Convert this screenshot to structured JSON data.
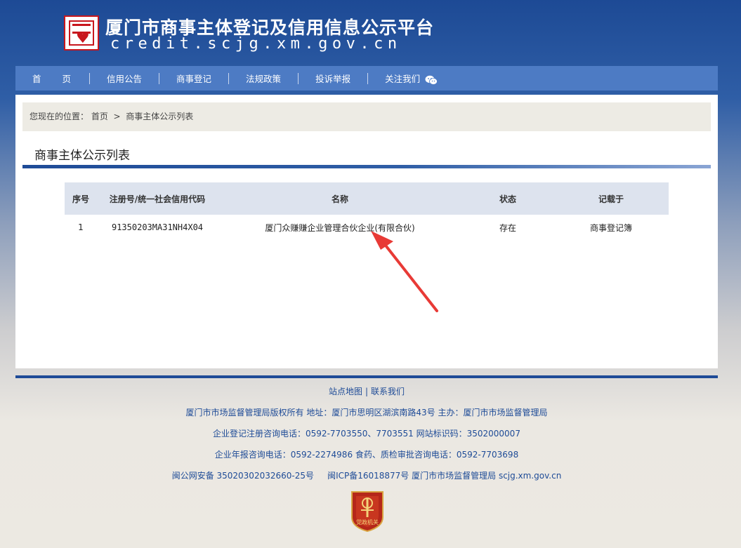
{
  "header": {
    "title": "厦门市商事主体登记及信用信息公示平台",
    "url": "credit.scjg.xm.gov.cn",
    "logo_icon": "credit-logo-icon"
  },
  "nav": {
    "items": [
      {
        "label": "首页"
      },
      {
        "label": "信用公告"
      },
      {
        "label": "商事登记"
      },
      {
        "label": "法规政策"
      },
      {
        "label": "投诉举报"
      },
      {
        "label": "关注我们"
      }
    ],
    "wechat_icon": "wechat-icon"
  },
  "breadcrumb": {
    "prefix": "您现在的位置：",
    "home": "首页",
    "separator": ">",
    "current": "商事主体公示列表"
  },
  "section": {
    "title": "商事主体公示列表"
  },
  "table": {
    "headers": [
      "序号",
      "注册号/统一社会信用代码",
      "名称",
      "状态",
      "记载于"
    ],
    "rows": [
      {
        "index": "1",
        "code": "91350203MA31NH4X04",
        "name": "厦门众赚赚企业管理合伙企业(有限合伙)",
        "status": "存在",
        "source": "商事登记簿"
      }
    ]
  },
  "footer": {
    "sitemap": "站点地图",
    "divider": "|",
    "contact": "联系我们",
    "copyright": "厦门市市场监督管理局版权所有 地址：厦门市思明区湖滨南路43号 主办：厦门市市场监督管理局",
    "phone1": "企业登记注册咨询电话：0592-7703550、7703551 网站标识码：3502000007",
    "phone2": "企业年报咨询电话：0592-2274986 食药、质检审批咨询电话：0592-7703698",
    "police": "闽公网安备 35020302032660-25号",
    "icp": "闽ICP备16018877号 厦门市市场监督管理局 scjg.xm.gov.cn",
    "badge_text": "党政机关"
  },
  "colors": {
    "brand_blue": "#1e4b97",
    "nav_blue": "#4d7bc4",
    "arrow_red": "#e83a36"
  }
}
